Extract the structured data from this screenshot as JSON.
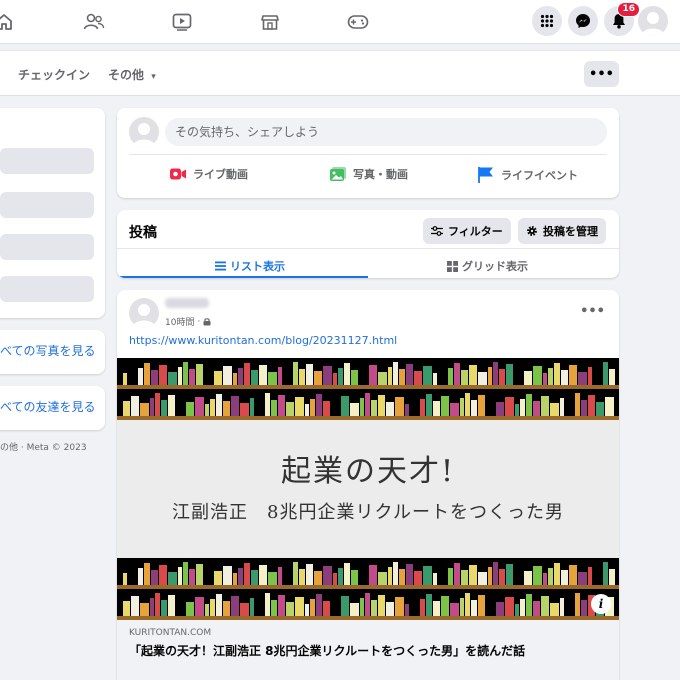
{
  "nav": {
    "icons": [
      "home-icon",
      "friends-icon",
      "watch-icon",
      "marketplace-icon",
      "gaming-icon"
    ],
    "notification_count": "16"
  },
  "profile_tabs": {
    "checkin": "チェックイン",
    "more": "その他",
    "more_caret": "▾",
    "dots": "•••"
  },
  "left": {
    "all_photos": "べての写真を見る",
    "all_friends": "べての友達を見る",
    "footer": "の他 · Meta © 2023"
  },
  "composer": {
    "placeholder": "その気持ち、シェアしよう",
    "actions": [
      "ライブ動画",
      "写真・動画",
      "ライフイベント"
    ]
  },
  "posts_header": {
    "title": "投稿",
    "filter_label": "フィルター",
    "manage_label": "投稿を管理",
    "list_view": "リスト表示",
    "grid_view": "グリッド表示"
  },
  "post": {
    "time": "10時間",
    "dot": "·",
    "dots": "•••",
    "url": "https://www.kuritontan.com/blog/20231127.html",
    "image_title": "起業の天才!",
    "image_subtitle": "江副浩正　8兆円企業リクルートをつくった男",
    "info_label": "i",
    "preview_domain": "KURITONTAN.COM",
    "preview_title": "「起業の天才！江副浩正 8兆円企業リクルートをつくった男」を読んだ話"
  },
  "colors": {
    "accent": "#1b74e4",
    "link": "#216fdb",
    "badge": "#e41e3f",
    "live_red": "#f02849",
    "photo_green": "#45bd62",
    "event_blue": "#1877f2"
  }
}
